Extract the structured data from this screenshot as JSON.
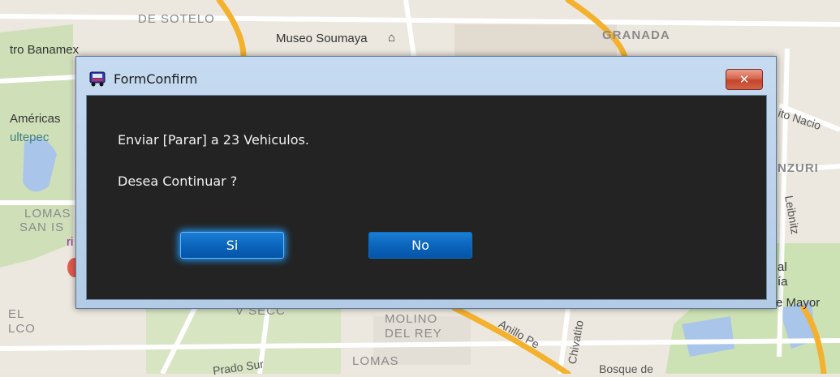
{
  "map": {
    "labels": {
      "lomas_de_sotelo": "DE SOTELO",
      "museo_soumaya": "Museo Soumaya",
      "granada": "GRANADA",
      "banamex": "tro Banamex",
      "americas": "Américas",
      "chapultepec": "ultepec",
      "lomas_san_isidro_1": "LOMAS",
      "lomas_san_isidro_2": "SAN IS",
      "ri": "ri",
      "circuito": "ito Nacio",
      "anzures": "NZURI",
      "leibnitz": "Leibnitz",
      "al": "al",
      "ia": "ía",
      "mayor": "e Mayor",
      "v_secc": "V SECC",
      "molino_1": "MOLINO",
      "molino_2": "DEL REY",
      "anillo": "Anillo Pe",
      "chivatito": "Chivatito",
      "lomas_bottom": "LOMAS",
      "prado_sur": "Prado Sur",
      "el": "EL",
      "lco": "LCO",
      "bosque": "Bosque de"
    }
  },
  "dialog": {
    "title": "FormConfirm",
    "close_glyph": "✕",
    "message_line1": "Enviar [Parar] a 23 Vehiculos.",
    "message_line2": "Desea Continuar ?",
    "yes_label": "Si",
    "no_label": "No"
  },
  "colors": {
    "client_background": "#232323",
    "button_blue": "#0a63ba",
    "close_red": "#c5452b",
    "titlebar_blue": "#b3cbe6"
  }
}
